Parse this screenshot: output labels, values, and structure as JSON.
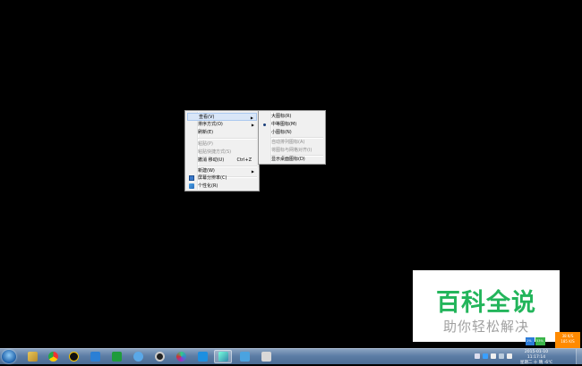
{
  "context_menu": {
    "items": [
      {
        "label": "查看(V)",
        "highlighted": true,
        "submenu": true
      },
      {
        "label": "排序方式(O)",
        "submenu": true
      },
      {
        "label": "刷新(E)"
      },
      {
        "label": "粘贴(P)",
        "disabled": true
      },
      {
        "label": "粘贴快捷方式(S)",
        "disabled": true
      },
      {
        "label": "撤消 移动(U)",
        "accel": "Ctrl+Z"
      },
      {
        "label": "新建(W)",
        "submenu": true
      },
      {
        "label": "屏幕分辨率(C)",
        "icon": "display-icon"
      },
      {
        "label": "个性化(R)",
        "icon": "personalize-icon"
      }
    ]
  },
  "view_submenu": {
    "items": [
      {
        "label": "大图标(R)"
      },
      {
        "label": "中等图标(M)",
        "selected": true
      },
      {
        "label": "小图标(N)"
      },
      {
        "label": "自动排列图标(A)",
        "disabled": true
      },
      {
        "label": "将图标与网格对齐(I)",
        "disabled": true
      },
      {
        "label": "显示桌面图标(D)"
      }
    ]
  },
  "watermark": {
    "title": "百科全说",
    "subtitle": "助你轻松解决"
  },
  "taskbar": {
    "pinned_icons": [
      "ie-icon",
      "folder-icon",
      "chrome-icon",
      "qq-icon",
      "bird-icon",
      "green-app-icon",
      "cloud-icon",
      "media-icon",
      "browser-icon",
      "screen-icon",
      "paint-icon",
      "window-icon",
      "tool-icon"
    ],
    "clock_time": "2015-01-10  11:17:14",
    "clock_date": "星期二  十 晴 -6℃"
  },
  "speed_widget": {
    "up": "38 K/S",
    "down": "185 K/S"
  },
  "net_widget": {
    "a": "1%",
    "b": "53%"
  }
}
